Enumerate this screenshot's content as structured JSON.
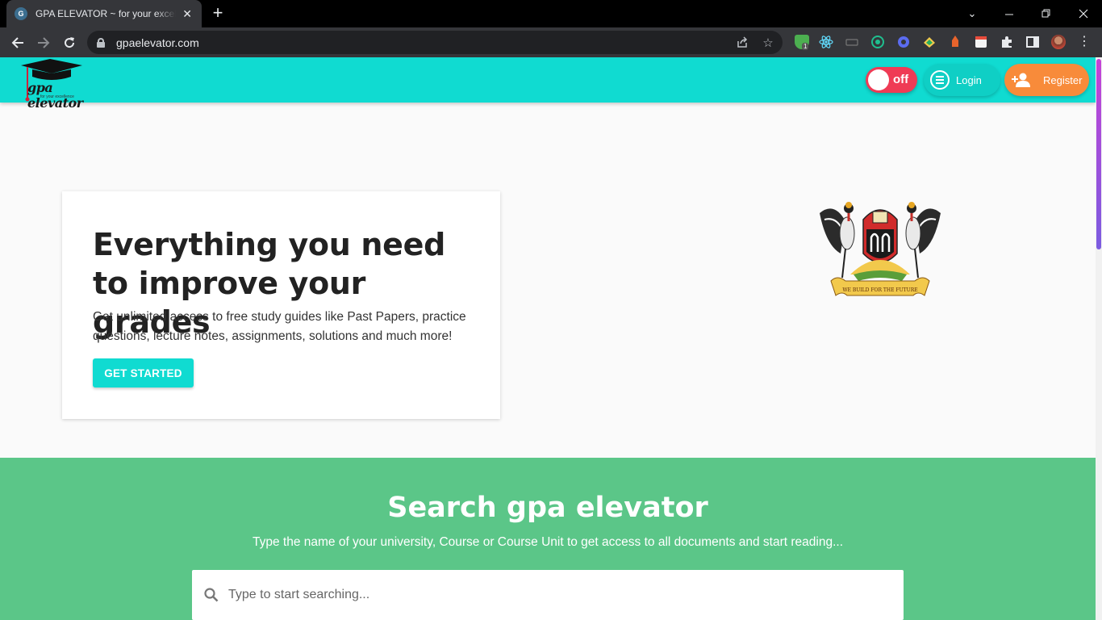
{
  "browser": {
    "tab_title": "GPA ELEVATOR ~ for your excellence",
    "favicon_letter": "G",
    "new_tab_symbol": "+",
    "url": "gpaelevator.com",
    "extension_badge": "1"
  },
  "site": {
    "logo_text": "gpa elevator",
    "logo_tagline": "for your excellence",
    "night_toggle_label": "off",
    "login_label": "Login",
    "register_label": "Register",
    "colors": {
      "header": "#10dbd1",
      "toggle": "#ef3b55",
      "register": "#f88b3a",
      "search_section": "#5bc688"
    }
  },
  "hero": {
    "title": "Everything you need to improve your grades",
    "subtitle": "Get unlimited access to free study guides like Past Papers, practice questions, lecture notes, assignments, solutions and much more!",
    "cta_label": "GET STARTED",
    "crest_motto": "WE BUILD FOR THE FUTURE"
  },
  "search": {
    "title": "Search gpa elevator",
    "subtitle": "Type the name of your university, Course or Course Unit to get access to all documents and start reading...",
    "placeholder": "Type to start searching..."
  }
}
